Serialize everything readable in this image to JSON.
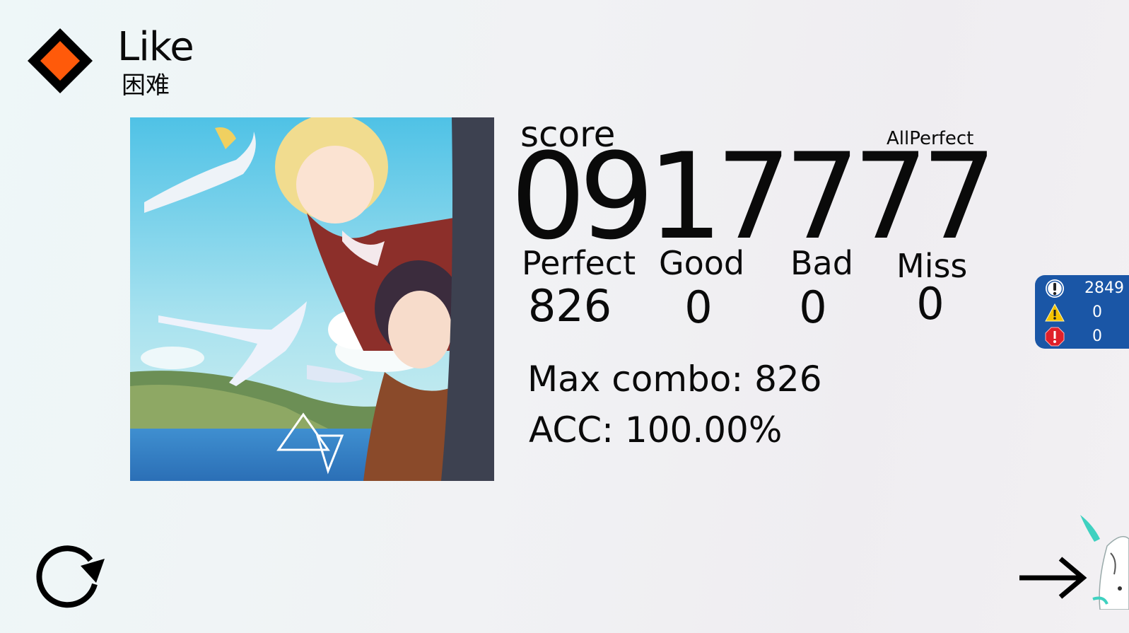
{
  "song": {
    "title": "Like",
    "difficulty": "困难"
  },
  "result": {
    "score_label": "score",
    "score": "0917777",
    "rank": "AllPerfect"
  },
  "judgements": [
    {
      "label": "Perfect",
      "value": "826"
    },
    {
      "label": "Good",
      "value": "0"
    },
    {
      "label": "Bad",
      "value": "0"
    },
    {
      "label": "Miss",
      "value": "0"
    }
  ],
  "summary": {
    "max_combo": "Max combo: 826",
    "acc": "ACC: 100.00%"
  },
  "side_panel": {
    "rows": [
      {
        "icon": "info-circle-icon",
        "value": "2849",
        "color": "#ffffff"
      },
      {
        "icon": "warning-triangle-icon",
        "value": "0",
        "color": "#f5c400"
      },
      {
        "icon": "error-octagon-icon",
        "value": "0",
        "color": "#e0202a"
      }
    ]
  },
  "colors": {
    "diamond_outer": "#000000",
    "diamond_inner": "#ff5a0a",
    "panel": "#1a56a6"
  },
  "icons": {
    "difficulty": "diamond-icon",
    "retry": "retry-arrow-icon",
    "next": "arrow-right-icon"
  }
}
